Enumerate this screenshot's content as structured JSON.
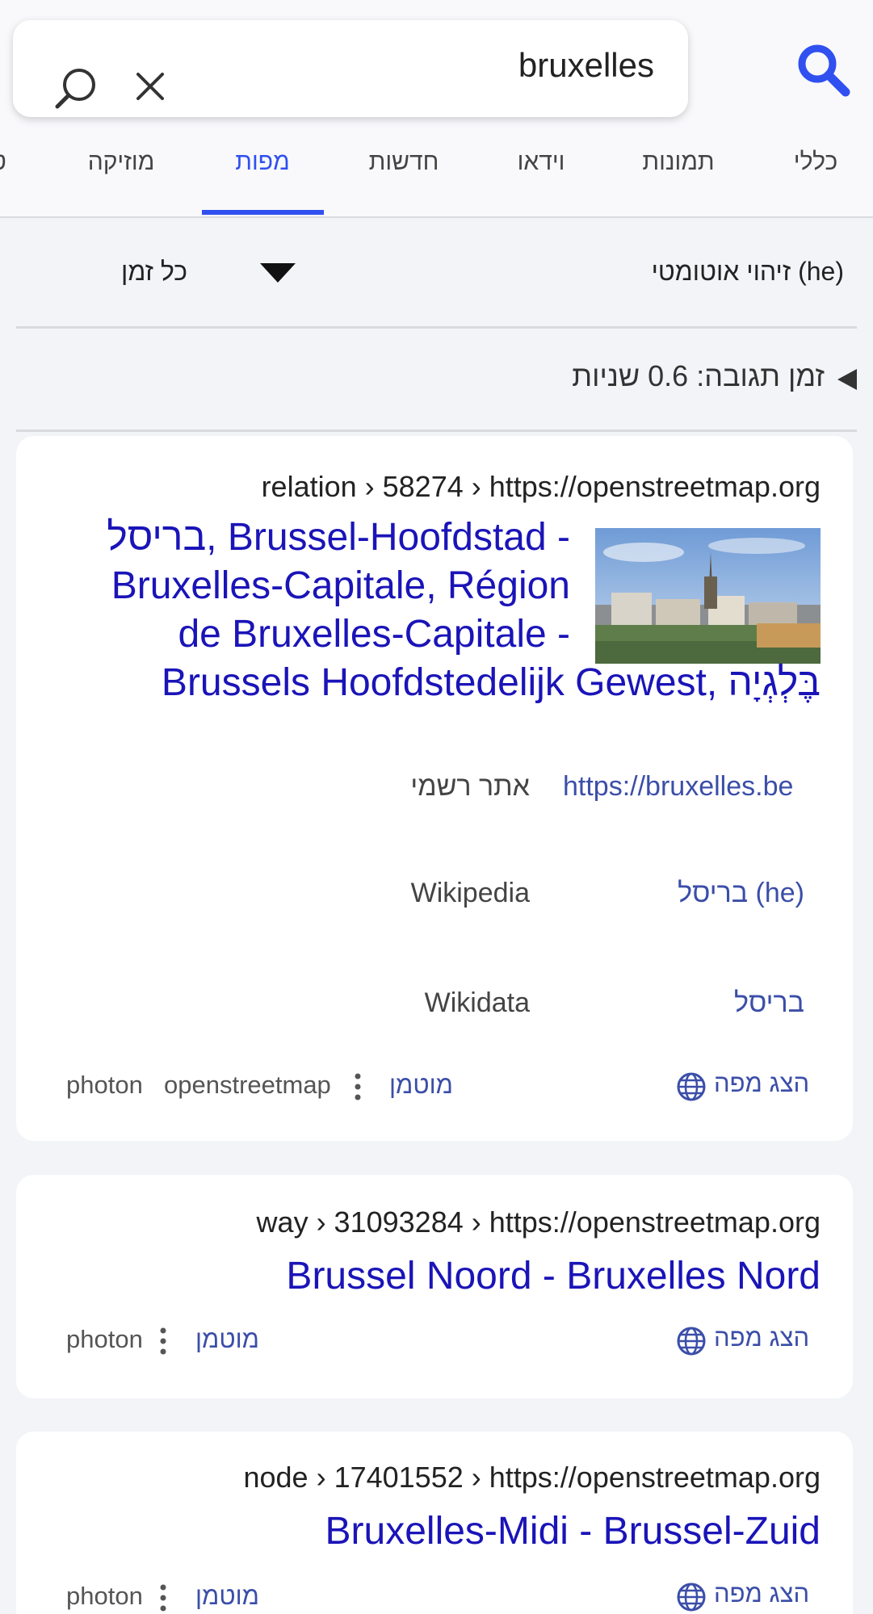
{
  "search": {
    "query": "bruxelles"
  },
  "tabs": [
    {
      "label": "כללי"
    },
    {
      "label": "תמונות"
    },
    {
      "label": "וידאו"
    },
    {
      "label": "חדשות"
    },
    {
      "label": "מפות",
      "active": true
    },
    {
      "label": "מוזיקה"
    },
    {
      "label": "ט"
    }
  ],
  "filters": {
    "language": "זיהוי אוטומטי (he)",
    "time": "כל זמן"
  },
  "response_time": "זמן תגובה: 0.6 שניות",
  "results": [
    {
      "url_domain": "https://openstreetmap.org",
      "url_path": "relation › 58274 ›",
      "title_lines": [
        "בריסל, Brussel-Hoofdstad -",
        "Bruxelles-Capitale, Région",
        "de Bruxelles-Capitale -",
        "Brussels Hoofdstedelijk Gewest, בֶּלְגְיָה"
      ],
      "details": [
        {
          "key": "אתר רשמי",
          "value": "https://bruxelles.be"
        },
        {
          "key": "Wikipedia",
          "value": "(he) בריסל"
        },
        {
          "key": "Wikidata",
          "value": "בריסל"
        }
      ],
      "show_map": "הצג מפה",
      "cached": "מוטמן",
      "engines": [
        "openstreetmap",
        "photon"
      ]
    },
    {
      "url_domain": "https://openstreetmap.org",
      "url_path": "way › 31093284 ›",
      "title": "Brussel Noord - Bruxelles Nord",
      "show_map": "הצג מפה",
      "cached": "מוטמן",
      "engines": [
        "photon"
      ]
    },
    {
      "url_domain": "https://openstreetmap.org",
      "url_path": "node › 17401552 ›",
      "title": "Bruxelles-Midi - Brussel-Zuid",
      "show_map": "הצג מפה",
      "cached": "מוטמן",
      "engines": [
        "photon"
      ]
    }
  ],
  "colors": {
    "accent": "#3050f0",
    "link": "#1a14b8",
    "secondary_link": "#3b4ea8",
    "background": "#f2f4f7"
  }
}
